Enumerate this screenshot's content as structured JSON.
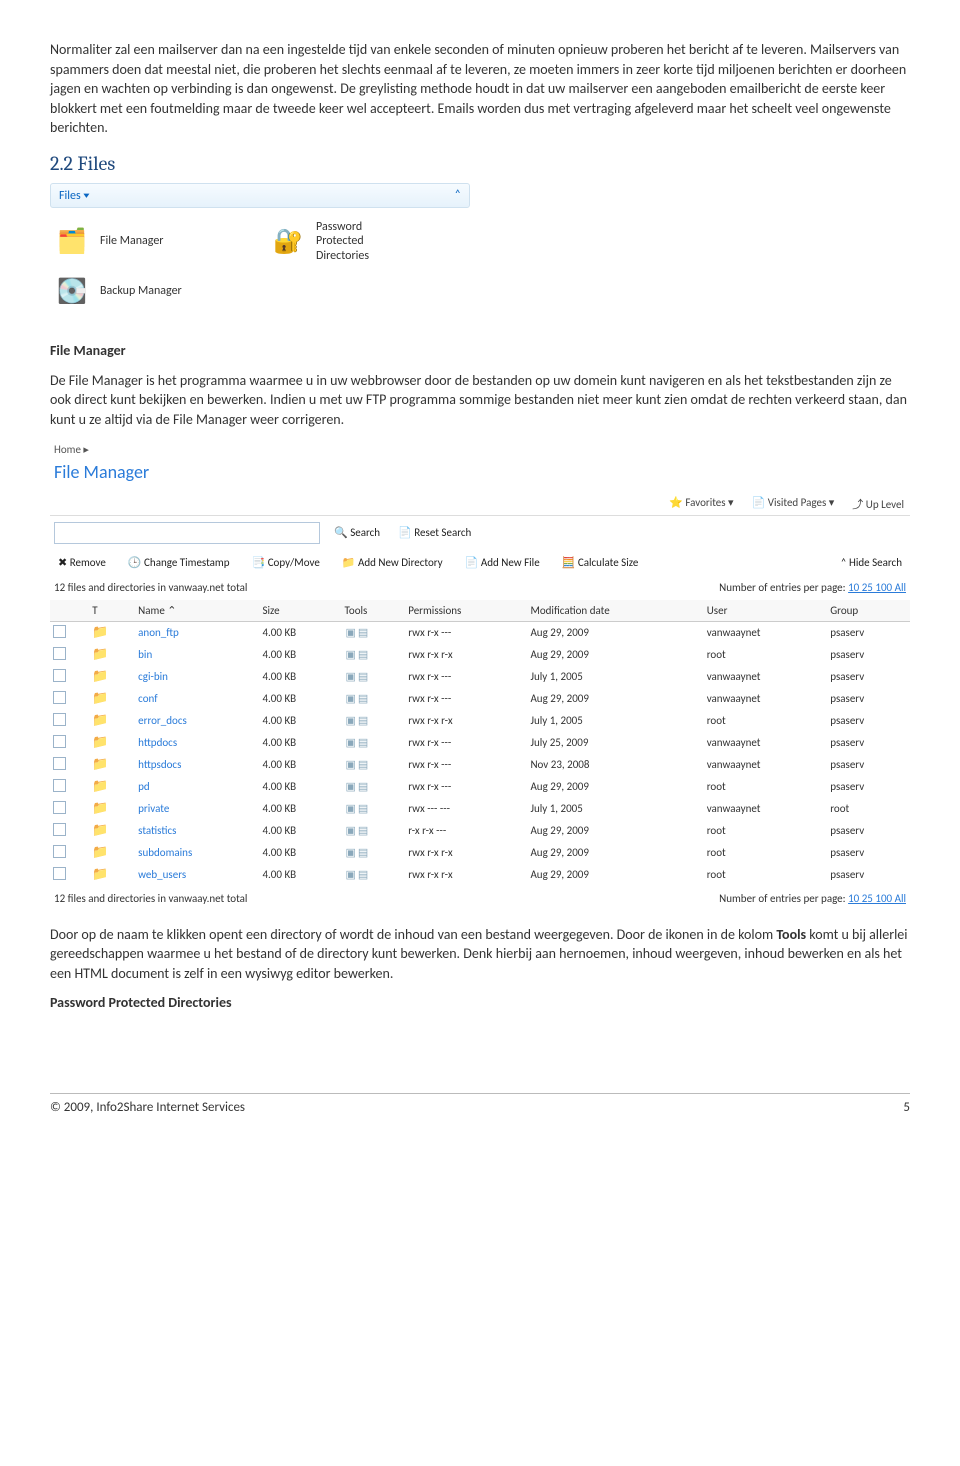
{
  "para1": "Normaliter zal een mailserver dan na een ingestelde  tijd van enkele seconden of minuten opnieuw proberen het bericht af te leveren. Mailservers van spammers doen dat meestal niet, die  proberen het slechts eenmaal af te leveren, ze moeten immers in zeer korte tijd miljoenen berichten er doorheen jagen en wachten op verbinding is dan ongewenst. De greylisting methode houdt in dat uw mailserver een aangeboden emailbericht de eerste keer blokkert  met een foutmelding maar de tweede keer wel accepteert. Emails worden dus met vertraging afgeleverd maar het scheelt veel  ongewenste berichten.",
  "h2": "2.2 Files",
  "panel": {
    "header": "Files",
    "items": [
      {
        "label": "File Manager"
      },
      {
        "label": "Password\nProtected\nDirectories"
      },
      {
        "label": "Backup Manager"
      }
    ]
  },
  "fm_heading": "File Manager",
  "para2": "De File Manager is het programma waarmee u in uw webbrowser door de bestanden op uw domein kunt navigeren en als het  tekstbestanden zijn ze ook direct kunt bekijken en bewerken. Indien u met uw FTP programma sommige bestanden niet meer kunt  zien omdat de rechten verkeerd staan, dan kunt u ze altijd via de File Manager weer corrigeren.",
  "fm": {
    "bread": "Home  ▸",
    "title": "File Manager",
    "fav": [
      "Favorites ▾",
      "Visited Pages ▾",
      "Up Level"
    ],
    "search_btn": "Search",
    "reset_btn": "Reset Search",
    "tools": [
      "Remove",
      "Change Timestamp",
      "Copy/Move",
      "Add New Directory",
      "Add New File",
      "Calculate Size"
    ],
    "hide": "Hide Search",
    "summary_left": "12 files and directories in vanwaay.net total",
    "summary_right_label": "Number of entries per page:",
    "summary_right_links": "10 25 100 All",
    "columns": [
      "",
      "T",
      "Name ⌃",
      "Size",
      "Tools",
      "Permissions",
      "Modification date",
      "User",
      "Group"
    ],
    "rows": [
      {
        "name": "anon_ftp",
        "size": "4.00 KB",
        "perm": "rwx r-x ---",
        "date": "Aug 29, 2009",
        "user": "vanwaaynet",
        "group": "psaserv"
      },
      {
        "name": "bin",
        "size": "4.00 KB",
        "perm": "rwx r-x r-x",
        "date": "Aug 29, 2009",
        "user": "root",
        "group": "psaserv"
      },
      {
        "name": "cgi-bin",
        "size": "4.00 KB",
        "perm": "rwx r-x ---",
        "date": "July 1, 2005",
        "user": "vanwaaynet",
        "group": "psaserv"
      },
      {
        "name": "conf",
        "size": "4.00 KB",
        "perm": "rwx r-x ---",
        "date": "Aug 29, 2009",
        "user": "vanwaaynet",
        "group": "psaserv"
      },
      {
        "name": "error_docs",
        "size": "4.00 KB",
        "perm": "rwx r-x r-x",
        "date": "July 1, 2005",
        "user": "root",
        "group": "psaserv"
      },
      {
        "name": "httpdocs",
        "size": "4.00 KB",
        "perm": "rwx r-x ---",
        "date": "July 25, 2009",
        "user": "vanwaaynet",
        "group": "psaserv"
      },
      {
        "name": "httpsdocs",
        "size": "4.00 KB",
        "perm": "rwx r-x ---",
        "date": "Nov 23, 2008",
        "user": "vanwaaynet",
        "group": "psaserv"
      },
      {
        "name": "pd",
        "size": "4.00 KB",
        "perm": "rwx r-x ---",
        "date": "Aug 29, 2009",
        "user": "root",
        "group": "psaserv"
      },
      {
        "name": "private",
        "size": "4.00 KB",
        "perm": "rwx --- ---",
        "date": "July 1, 2005",
        "user": "vanwaaynet",
        "group": "root"
      },
      {
        "name": "statistics",
        "size": "4.00 KB",
        "perm": "r-x r-x ---",
        "date": "Aug 29, 2009",
        "user": "root",
        "group": "psaserv"
      },
      {
        "name": "subdomains",
        "size": "4.00 KB",
        "perm": "rwx r-x r-x",
        "date": "Aug 29, 2009",
        "user": "root",
        "group": "psaserv"
      },
      {
        "name": "web_users",
        "size": "4.00 KB",
        "perm": "rwx r-x r-x",
        "date": "Aug 29, 2009",
        "user": "root",
        "group": "psaserv"
      }
    ]
  },
  "para3a": "Door op de naam te klikken opent een directory of wordt de inhoud van een bestand weergegeven. Door de ikonen in de kolom ",
  "para3b": "Tools",
  "para3c": "  komt u bij allerlei gereedschappen waarmee u het bestand of de directory kunt bewerken. Denk hierbij aan hernoemen, inhoud  weergeven, inhoud bewerken en als het een HTML document is zelf in een wysiwyg editor bewerken.",
  "ppd_heading": "Password Protected Directories",
  "footer_left": "© 2009, Info2Share Internet Services",
  "footer_right": "5"
}
